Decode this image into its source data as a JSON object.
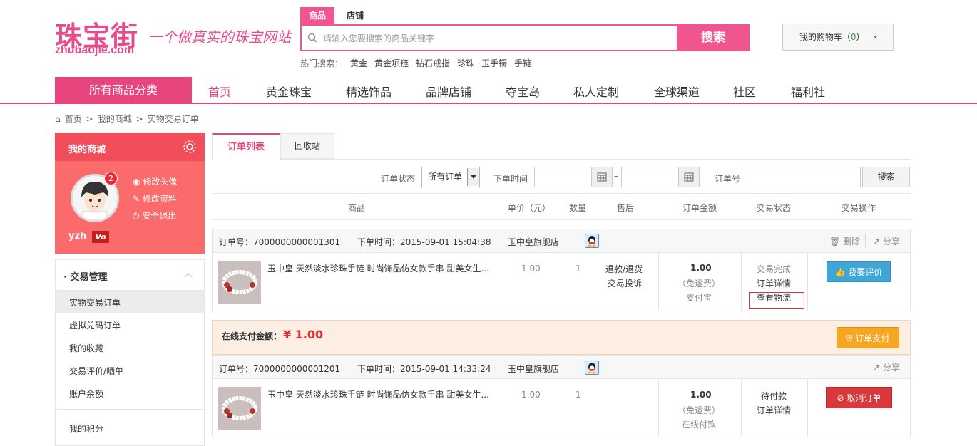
{
  "header": {
    "logo_cn": "珠宝街",
    "logo_en": "zhubaojie.com",
    "slogan": "一个做真实的珠宝网站",
    "search_tabs": [
      "商品",
      "店铺"
    ],
    "search_placeholder": "请输入您要搜索的商品关键字",
    "search_button": "搜索",
    "hot_label": "热门搜索：",
    "hot_words": [
      "黄金",
      "黄金项链",
      "钻石戒指",
      "珍珠",
      "玉手镯",
      "手链"
    ],
    "cart_label": "我的购物车（",
    "cart_count": "0",
    "cart_close": "）",
    "cart_arrow": "›"
  },
  "nav": {
    "all_categories": "所有商品分类",
    "items": [
      "首页",
      "黄金珠宝",
      "精选饰品",
      "品牌店铺",
      "夺宝岛",
      "私人定制",
      "全球渠道",
      "社区",
      "福利社"
    ]
  },
  "breadcrumb": [
    "首页",
    ">",
    "我的商城",
    ">",
    "实物交易订单"
  ],
  "sidebar": {
    "title": "我的商城",
    "badge": "2",
    "links": [
      "修改头像",
      "修改资料",
      "安全退出"
    ],
    "username": "yzh",
    "vip": "Vo",
    "menu_title": "· 交易管理",
    "menu_items": [
      "实物交易订单",
      "虚拟兑码订单",
      "我的收藏",
      "交易评价/晒单",
      "账户余额",
      "我的积分"
    ]
  },
  "tabs": [
    "订单列表",
    "回收站"
  ],
  "filter": {
    "status_label": "订单状态",
    "status_value": "所有订单",
    "time_label": "下单时间",
    "dash": "–",
    "order_label": "订单号",
    "search_btn": "搜索"
  },
  "columns": [
    "商品",
    "单价（元）",
    "数量",
    "售后",
    "订单金额",
    "交易状态",
    "交易操作"
  ],
  "orders": [
    {
      "order_no": "订单号：7000000000001301",
      "time": "下单时间：2015-09-01 15:04:38",
      "shop": "玉中皇旗舰店",
      "delete": "删除",
      "share": "分享",
      "product": "玉中皇 天然淡水珍珠手链 时尚饰品仿女款手串 甜美女生...",
      "price": "1.00",
      "qty": "1",
      "after": [
        "退款/退货",
        "交易投诉"
      ],
      "amount": "1.00",
      "ship": "（免运费）",
      "pay_method": "支付宝",
      "status": "交易完成",
      "detail": "订单详情",
      "logistics": "查看物流",
      "action": "我要评价"
    },
    {
      "order_no": "订单号：7000000000001201",
      "time": "下单时间：2015-09-01 14:33:24",
      "shop": "玉中皇旗舰店",
      "share": "分享",
      "product": "玉中皇 天然淡水珍珠手链 时尚饰品仿女款手串 甜美女生...",
      "price": "1.00",
      "qty": "1",
      "amount": "1.00",
      "ship": "（免运费）",
      "pay_method": "在线付款",
      "status": "待付款",
      "detail": "订单详情",
      "action": "取消订单"
    }
  ],
  "pay_bar": {
    "label": "在线支付金额：",
    "amount": "¥ 1.00",
    "button": "订单支付"
  },
  "colors": {
    "accent": "#e8457f",
    "sidebar_head": "#f14d5a",
    "sidebar_body": "#fb6b6b",
    "rate_btn": "#3fa7d8",
    "pay_btn": "#f5a623",
    "cancel_btn": "#d9383c"
  }
}
